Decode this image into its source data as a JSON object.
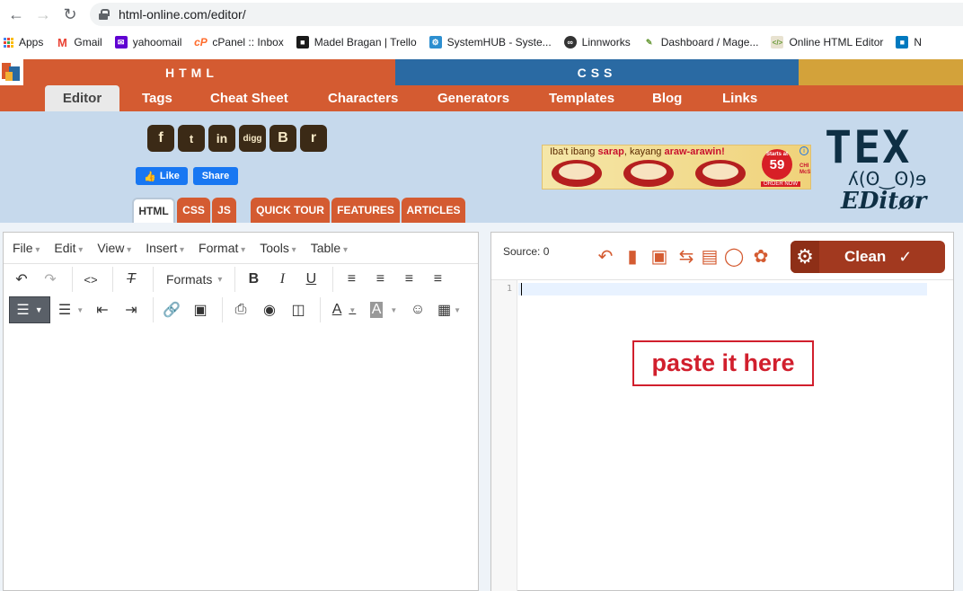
{
  "browser": {
    "url": "html-online.com/editor/",
    "bookmarks": [
      {
        "label": "Apps",
        "icon": "apps-icon"
      },
      {
        "label": "Gmail",
        "icon": "gmail-icon",
        "color": "#ea4335"
      },
      {
        "label": "yahoomail",
        "icon": "yahoo-icon",
        "color": "#6001d2"
      },
      {
        "label": "cPanel :: Inbox",
        "icon": "cpanel-icon",
        "color": "#ff6c2c"
      },
      {
        "label": "Madel Bragan | Trello",
        "icon": "trello-icon",
        "color": "#1a1a1a"
      },
      {
        "label": "SystemHUB - Syste...",
        "icon": "systemhub-icon",
        "color": "#2d8fd0"
      },
      {
        "label": "Linnworks",
        "icon": "linnworks-icon",
        "color": "#333333"
      },
      {
        "label": "Dashboard / Mage...",
        "icon": "magento-icon",
        "color": "#6a9b3a"
      },
      {
        "label": "Online HTML Editor",
        "icon": "html-editor-icon",
        "color": "#6a9b3a"
      },
      {
        "label": "N",
        "icon": "trello-icon",
        "color": "#0079bf"
      }
    ]
  },
  "site": {
    "band_html": "HTML",
    "band_css": "CSS",
    "nav": [
      "Editor",
      "Tags",
      "Cheat Sheet",
      "Characters",
      "Generators",
      "Templates",
      "Blog",
      "Links"
    ],
    "social": [
      "facebook-icon",
      "twitter-icon",
      "linkedin-icon",
      "digg-icon",
      "blogger-icon",
      "reddit-icon"
    ],
    "social_glyphs": [
      "f",
      "t",
      "in",
      "digg",
      "B",
      "r"
    ],
    "fb_like": "Like",
    "fb_share": "Share",
    "lang_tabs": [
      "HTML",
      "CSS",
      "JS"
    ],
    "info_tabs": [
      "QUICK TOUR",
      "FEATURES",
      "ARTICLES"
    ],
    "ad": {
      "text_prefix": "Iba't ibang ",
      "text_emph": "sarap",
      "text_mid": ", kayang ",
      "text_emph2": "araw-arawin!",
      "price": "59",
      "price_prefix": "Starts at",
      "order": "ORDER NOW",
      "side": "CHI McSA"
    },
    "logo_line1": "TEX",
    "logo_line2": "ʎ(ʘ‿ʘ)ɘ",
    "logo_line3": "EDitør"
  },
  "wysiwyg": {
    "menu": [
      "File",
      "Edit",
      "View",
      "Insert",
      "Format",
      "Tools",
      "Table"
    ],
    "formats_label": "Formats"
  },
  "source": {
    "label": "Source: 0",
    "clean_label": "Clean",
    "line_number": "1",
    "annotation": "paste it here"
  }
}
